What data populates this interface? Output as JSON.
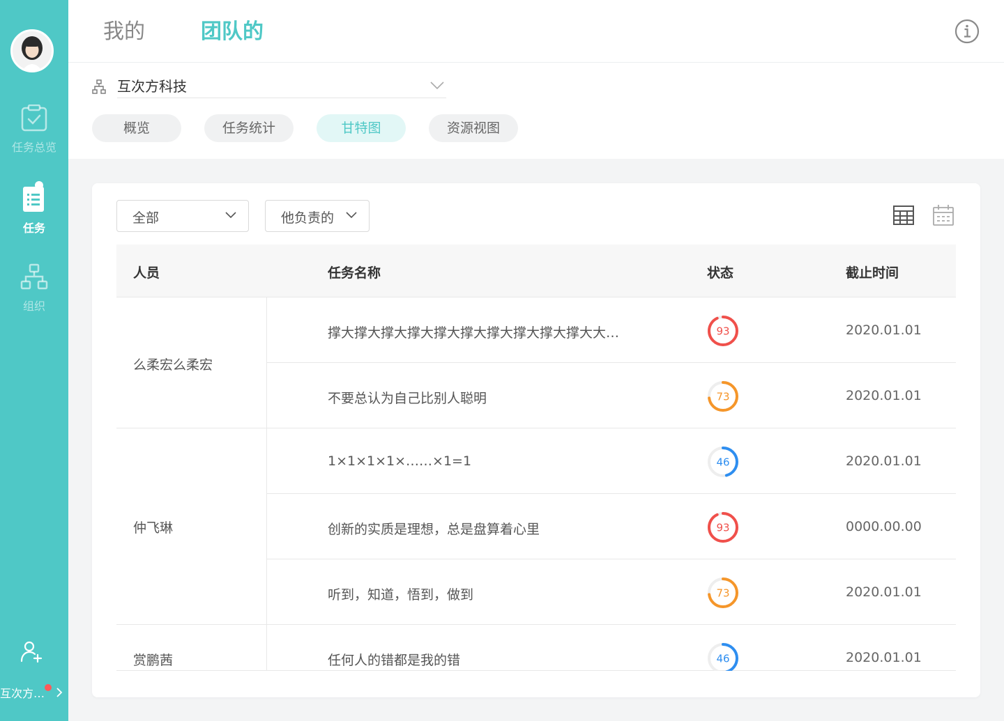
{
  "sidebar": {
    "nav": [
      {
        "label": "任务总览",
        "active": false
      },
      {
        "label": "任务",
        "active": true
      },
      {
        "label": "组织",
        "active": false
      }
    ],
    "company_switch": "互次方…"
  },
  "header": {
    "tabs": [
      {
        "label": "我的",
        "active": false
      },
      {
        "label": "团队的",
        "active": true
      }
    ],
    "org_name": "互次方科技",
    "sub_tabs": [
      {
        "label": "概览",
        "active": false
      },
      {
        "label": "任务统计",
        "active": false
      },
      {
        "label": "甘特图",
        "active": true
      },
      {
        "label": "资源视图",
        "active": false
      }
    ]
  },
  "filters": {
    "scope": "全部",
    "role": "他负责的"
  },
  "table": {
    "headers": {
      "person": "人员",
      "task": "任务名称",
      "status": "状态",
      "deadline": "截止时间"
    },
    "groups": [
      {
        "person": "么柔宏么柔宏",
        "tasks": [
          {
            "name": "撑大撑大撑大撑大撑大撑大撑大撑大撑大撑大大撑…",
            "status": 93,
            "deadline": "2020.01.01"
          },
          {
            "name": "不要总认为自己比别人聪明",
            "status": 73,
            "deadline": "2020.01.01"
          }
        ]
      },
      {
        "person": "仲飞琳",
        "tasks": [
          {
            "name": "1×1×1×1×……×1=1",
            "status": 46,
            "deadline": "2020.01.01"
          },
          {
            "name": "创新的实质是理想，总是盘算着心里",
            "status": 93,
            "deadline": "0000.00.00"
          },
          {
            "name": "听到，知道，悟到，做到",
            "status": 73,
            "deadline": "2020.01.01"
          }
        ]
      },
      {
        "person": "赏鹏茜",
        "tasks": [
          {
            "name": "任何人的错都是我的错",
            "status": 46,
            "deadline": "2020.01.01"
          }
        ]
      }
    ]
  },
  "colors": {
    "accent": "#4fc8c6",
    "status_high": "#f0504b",
    "status_mid": "#f5962a",
    "status_low": "#2e8ef0"
  }
}
